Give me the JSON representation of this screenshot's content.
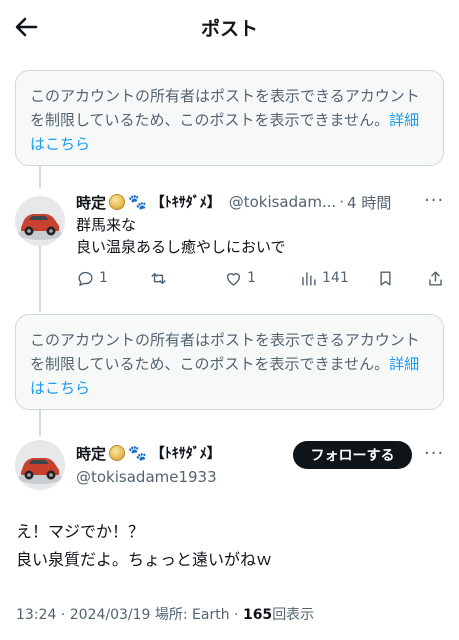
{
  "header": {
    "title": "ポスト",
    "back_icon": "arrow-left-icon"
  },
  "notices": [
    {
      "text": "このアカウントの所有者はポストを表示できるアカウントを制限しているため、このポストを表示できません。",
      "link": "詳細はこちら"
    },
    {
      "text": "このアカウントの所有者はポストを表示できるアカウントを制限しているため、このポストを表示できません。",
      "link": "詳細はこちら"
    }
  ],
  "reply": {
    "name": "時定",
    "tag": "【ﾄｷｻﾀﾞﾒ】",
    "handle": "@tokisadam...",
    "separator": "·",
    "time": "4 時間",
    "lines": [
      "群馬来な",
      "良い温泉あるし癒やしにおいで"
    ],
    "stats": {
      "replies": "1",
      "reposts": "",
      "likes": "1",
      "views": "141"
    }
  },
  "main_post": {
    "name": "時定",
    "tag": "【ﾄｷｻﾀﾞﾒ】",
    "handle": "@tokisadame1933",
    "follow_label": "フォローする",
    "lines": [
      "え！マジでか！？",
      "良い泉質だよ。ちょっと遠いがねｗ"
    ],
    "meta": {
      "time": "13:24",
      "separator": "·",
      "date": "2024/03/19",
      "place_label": "場所: Earth",
      "separator2": "·",
      "views": "165",
      "views_label": "回表示"
    }
  },
  "colors": {
    "accent": "#1d9bf0",
    "text": "#0f1419",
    "muted": "#536471",
    "border": "#cfd9de"
  }
}
